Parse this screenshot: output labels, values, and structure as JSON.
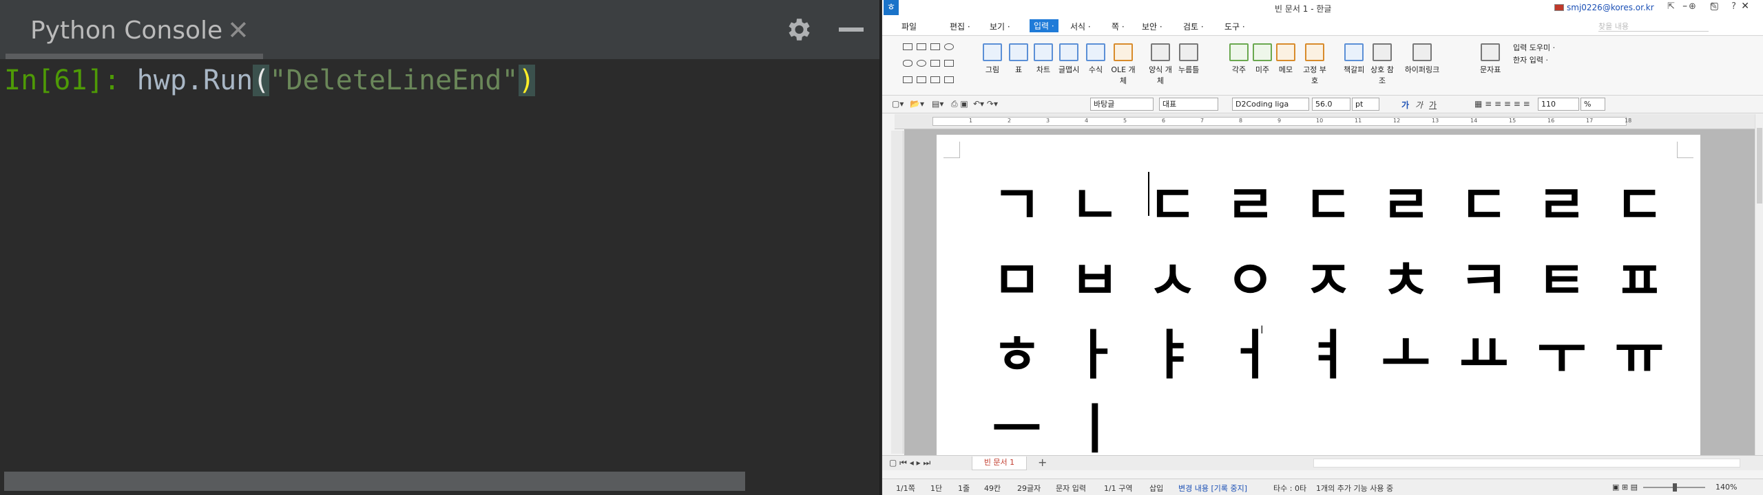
{
  "console": {
    "tab_title": "Python Console",
    "tab_close": "✕",
    "prompt": "In[61]: ",
    "fn": "hwp.Run",
    "paren_open": "(",
    "arg": "\"DeleteLineEnd\"",
    "paren_close": ")"
  },
  "hwp": {
    "app_icon": "ㅎ",
    "title": "빈 문서 1 - 한글",
    "account": "smj0226@kores.or.kr",
    "title_icons": "⇱ ⊕ ✎ ?",
    "window_controls": "– ▢ ✕",
    "menus": [
      "파일",
      "편집 ·",
      "보기 ·",
      "입력 ·",
      "서식 ·",
      "쪽 ·",
      "보안 ·",
      "검토 ·",
      "도구 ·"
    ],
    "active_menu": "입력 ·",
    "menu_search_placeholder": "찾을 내용",
    "ribbon": {
      "items": [
        "그림",
        "표",
        "차트",
        "글맵시",
        "수식",
        "OLE 개체",
        "양식 개체",
        "누름틀",
        "각주",
        "미주",
        "메모",
        "고정 부호",
        "책갈피",
        "상호 참조",
        "하이퍼링크",
        "문자표"
      ],
      "input_helper": "입력 도우미 ·",
      "hanja_input": "한자 입력 ·"
    },
    "toolbar": {
      "style": "바탕글",
      "lang": "대표",
      "font": "D2Coding liga",
      "size": "56.0",
      "unit": "pt",
      "bold": "가",
      "italic": "가",
      "underline": "가",
      "zoom_value": "110",
      "zoom_unit": "%"
    },
    "ruler_numbers": [
      "1",
      "2",
      "3",
      "4",
      "5",
      "6",
      "7",
      "8",
      "9",
      "10",
      "11",
      "12",
      "13",
      "14",
      "15",
      "16",
      "17",
      "18"
    ],
    "document": {
      "row1": [
        "ㄱ",
        "ㄴ",
        "ㄷ",
        "ㄹ",
        "ㄷ",
        "ㄹ",
        "ㄷ",
        "ㄹ",
        "ㄷ"
      ],
      "row2": [
        "ㅁ",
        "ㅂ",
        "ㅅ",
        "ㅇ",
        "ㅈ",
        "ㅊ",
        "ㅋ",
        "ㅌ",
        "ㅍ"
      ],
      "row3": [
        "ㅎ",
        "ㅏ",
        "ㅑ",
        "ㅓ",
        "ㅕ",
        "ㅗ",
        "ㅛ",
        "ㅜ",
        "ㅠ"
      ],
      "row4": [
        "ㅡ",
        "ㅣ"
      ]
    },
    "doc_tab": "빈 문서 1",
    "doc_tab_add": "+",
    "status": {
      "page": "1/1쪽",
      "column": "1단",
      "line": "1줄",
      "col": "49칸",
      "chars": "29글자",
      "mode": "문자 입력",
      "section": "1/1 구역",
      "insert": "삽입",
      "track": "변경 내용 [기록 중지]",
      "typing": "타수 : 0타",
      "extra": "1개의 추가 기능 사용 중",
      "zoom": "140%"
    },
    "colors": {
      "accent": "#1f7bd8",
      "doc_tab_text": "#c0392b"
    }
  }
}
